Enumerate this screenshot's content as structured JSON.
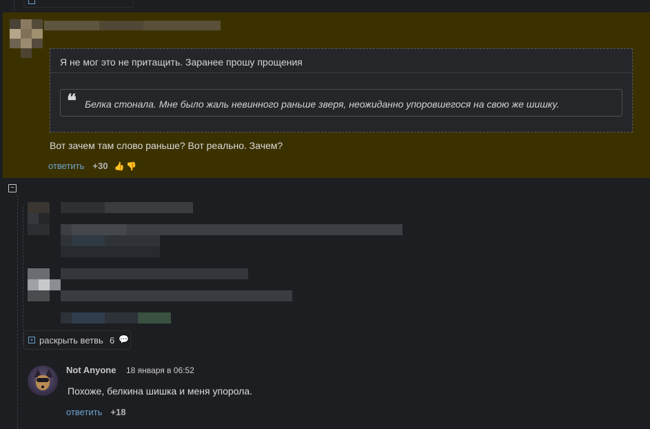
{
  "highlight_comment": {
    "quote_header": "Я не мог это не притащить. Заранее прошу прощения",
    "inner_quote_mark": "❝",
    "inner_quote_text": "Белка стонала. Мне было жаль невинного раньше зверя, неожиданно упоровшегося на свою же шишку.",
    "text": "Вот зачем там слово раньше? Вот реально. Зачем?",
    "reply_label": "ответить",
    "score": "+30",
    "like_icon": "👍",
    "dislike_icon": "👎"
  },
  "thread": {
    "collapse_symbol": "−"
  },
  "expand_branch": {
    "plus_symbol": "+",
    "label": "раскрыть ветвь",
    "count": "6",
    "comments_icon": "💬"
  },
  "comment2": {
    "author": "Not Anyone",
    "date": "18 января в 06:52",
    "text": "Похоже, белкина шишка и меня упорола.",
    "reply_label": "ответить",
    "score": "+18"
  },
  "colors": {
    "background": "#1d1e22",
    "highlight": "#3b3100",
    "link": "#6ea3cf",
    "like": "#7dbb3c"
  }
}
